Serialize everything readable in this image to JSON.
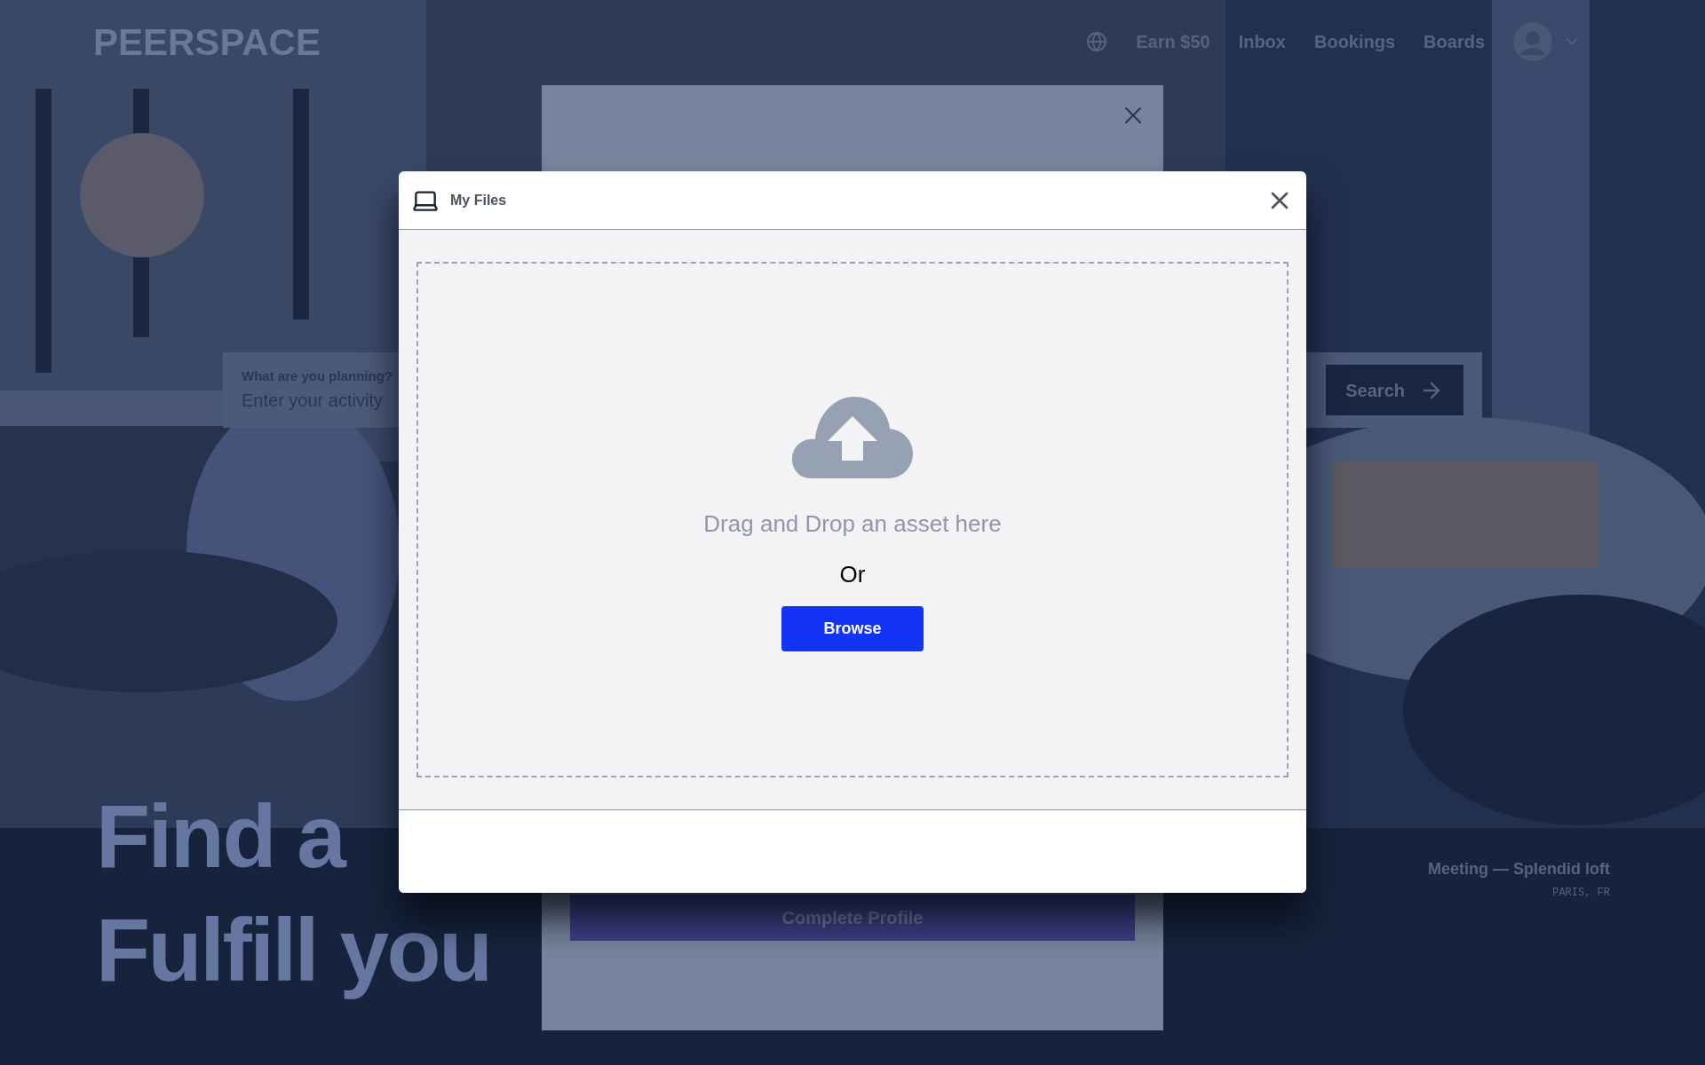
{
  "nav": {
    "logo": "PEERSPACE",
    "links": [
      "Earn $50",
      "Inbox",
      "Bookings",
      "Boards"
    ]
  },
  "search": {
    "label": "What are you planning?",
    "placeholder": "Enter your activity",
    "button": "Search"
  },
  "hero": {
    "lines": [
      "Find a",
      "Fulfill you"
    ],
    "caption": "Meeting — Splendid loft",
    "location": "PARIS, FR"
  },
  "back_dialog": {
    "button": "Complete Profile"
  },
  "dialog": {
    "title": "My Files",
    "drop_text": "Drag and Drop an asset here",
    "or": "Or",
    "button": "Browse"
  }
}
